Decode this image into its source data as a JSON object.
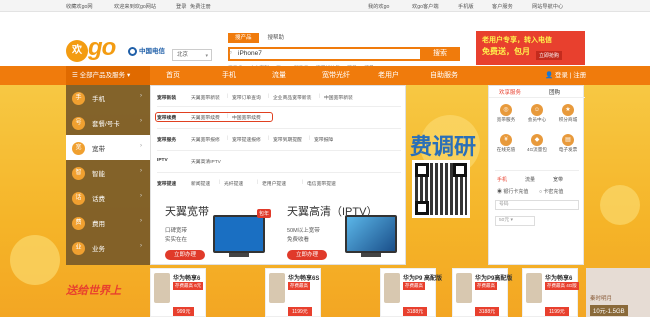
{
  "topbar": {
    "favorite": "收藏欢go网",
    "welcome": "欢迎来到欢go网站",
    "login": "登录",
    "register": "免费注册",
    "my_hgo": "我的欢go",
    "shop": "欢go客户端",
    "mobile": "手机版",
    "service": "客户服务",
    "site_nav": "网站导航中心"
  },
  "header": {
    "brand_letter": "欢",
    "brand": "go",
    "operator": "中国电信",
    "city": "北京",
    "search_tabs": [
      "搜产品",
      "搜帮助"
    ],
    "search_value": "iPhone7",
    "search_button": "搜索",
    "hot_words": [
      "天云卡",
      "小人定制",
      "飞young智能云",
      "流量加油包",
      "购号",
      "流量"
    ],
    "ad_line1": "老用户专享，转入电信",
    "ad_line2": "免费送，包月",
    "ad_cta": "立即抢购"
  },
  "nav": {
    "all_products": "全部产品及服务",
    "items": [
      "首页",
      "手机",
      "流量",
      "宽带光纤",
      "老用户",
      "自助服务"
    ],
    "login": "登录 | 注册"
  },
  "categories": [
    {
      "icon": "手",
      "label": "手机",
      "icon_name": "phone-icon"
    },
    {
      "icon": "号",
      "label": "套餐/号卡",
      "icon_name": "sim-icon"
    },
    {
      "icon": "宽",
      "label": "宽带",
      "icon_name": "broadband-icon"
    },
    {
      "icon": "智",
      "label": "智能",
      "icon_name": "smart-icon"
    },
    {
      "icon": "话",
      "label": "话费",
      "icon_name": "recharge-icon"
    },
    {
      "icon": "费",
      "label": "费用",
      "icon_name": "bill-icon"
    },
    {
      "icon": "业",
      "label": "业务",
      "icon_name": "service-icon"
    }
  ],
  "flyout": {
    "rows": [
      {
        "head": "宽带新装",
        "items": [
          "天翼宽带新装",
          "宽带订单查询",
          "企业商品宽带新装",
          "中国宽带新装"
        ]
      },
      {
        "head": "宽带续费",
        "items": [
          "天翼宽带续费",
          "中国宽带续费"
        ]
      },
      {
        "head": "宽带服务",
        "items": [
          "天翼宽带报修",
          "宽带提速报修",
          "宽带到期提醒",
          "宽带报障"
        ]
      },
      {
        "head": "IPTV",
        "items": [
          "天翼高清IPTV"
        ]
      },
      {
        "head": "宽带提速",
        "items": [
          "新闻提速",
          "光纤提速",
          "老用户提速",
          "电信宽带提速"
        ]
      }
    ],
    "promo1": {
      "title": "天翼宽带",
      "sub1": "口碑宽带",
      "sub2": "实实在在",
      "btn": "立即办理",
      "tag": "包年"
    },
    "promo2": {
      "title": "天翼高清（IPTV）",
      "sub1": "50M以上宽带",
      "sub2": "免费收看",
      "btn": "立即办理"
    }
  },
  "banner_text": "费调研",
  "right_panel": {
    "tabs": [
      "欢享服务",
      "团购"
    ],
    "icons": [
      {
        "label": "宽带服务",
        "icon_name": "broadband-service-icon"
      },
      {
        "label": "会员中心",
        "icon_name": "member-center-icon"
      },
      {
        "label": "积分商城",
        "icon_name": "points-mall-icon"
      },
      {
        "label": "在线充值",
        "icon_name": "online-recharge-icon"
      },
      {
        "label": "4G流量包",
        "icon_name": "data-package-icon"
      },
      {
        "label": "电子发票",
        "icon_name": "invoice-icon"
      }
    ],
    "sub_tabs": [
      "手机",
      "流量",
      "宽带"
    ],
    "radio1": "银行卡充值",
    "radio2": "卡密充值",
    "field_label": "号码",
    "amount": "50元"
  },
  "products": [
    {
      "name": "华为畅享6",
      "tag": "存费最高 6元",
      "price": "999元"
    },
    {
      "name": "华为畅享6S",
      "tag": "存费最高",
      "price": "1199元"
    },
    {
      "name": "华为P9 高配版",
      "tag": "存费最高",
      "price": "3188元"
    },
    {
      "name": "华为P9高配版",
      "tag": "存费最高",
      "price": "3188元"
    },
    {
      "name": "华为畅享6",
      "tag": "存费最高 4G版",
      "price": "1199元"
    }
  ],
  "bottom_left": "送给世界上",
  "right_ad": {
    "title": "秦时明月",
    "price": "10元-1.5GB"
  }
}
